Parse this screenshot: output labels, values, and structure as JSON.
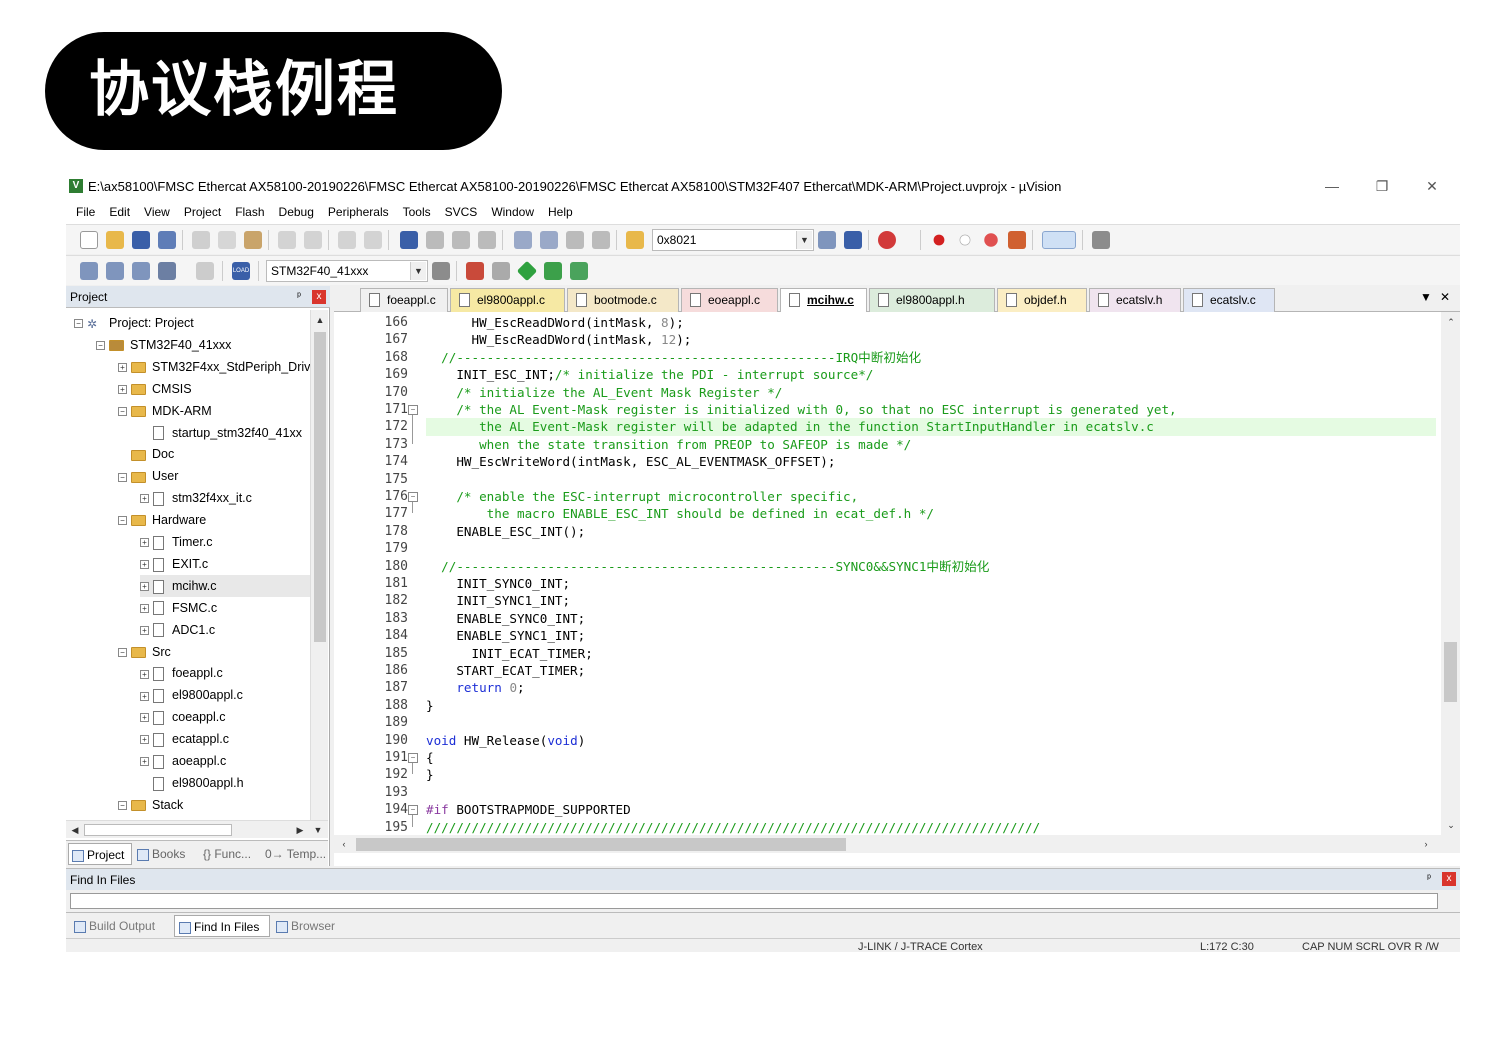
{
  "banner": {
    "title": "协议栈例程"
  },
  "window": {
    "title": "E:\\ax58100\\FMSC Ethercat AX58100-20190226\\FMSC Ethercat AX58100-20190226\\FMSC Ethercat AX58100\\STM32F407 Ethercat\\MDK-ARM\\Project.uvprojx - µVision",
    "controls": {
      "minimize": "—",
      "restore": "❐",
      "close": "✕"
    }
  },
  "menu": [
    "File",
    "Edit",
    "View",
    "Project",
    "Flash",
    "Debug",
    "Peripherals",
    "Tools",
    "SVCS",
    "Window",
    "Help"
  ],
  "toolbar": {
    "address_value": "0x8021",
    "target_value": "STM32F40_41xxx",
    "load_icon_label": "LOAD"
  },
  "project_panel": {
    "title": "Project",
    "pin": "ᵖ",
    "close": "x",
    "tree": [
      {
        "label": "Project: Project",
        "level": 0,
        "type": "project",
        "expander": "−"
      },
      {
        "label": "STM32F40_41xxx",
        "level": 1,
        "type": "target",
        "expander": "−"
      },
      {
        "label": "STM32F4xx_StdPeriph_Driv",
        "level": 2,
        "type": "folder",
        "expander": "+"
      },
      {
        "label": "CMSIS",
        "level": 2,
        "type": "folder",
        "expander": "+"
      },
      {
        "label": "MDK-ARM",
        "level": 2,
        "type": "folder",
        "expander": "−"
      },
      {
        "label": "startup_stm32f40_41xx",
        "level": 3,
        "type": "file",
        "expander": ""
      },
      {
        "label": "Doc",
        "level": 2,
        "type": "folder",
        "expander": ""
      },
      {
        "label": "User",
        "level": 2,
        "type": "folder",
        "expander": "−"
      },
      {
        "label": "stm32f4xx_it.c",
        "level": 3,
        "type": "file",
        "expander": "+"
      },
      {
        "label": "Hardware",
        "level": 2,
        "type": "folder",
        "expander": "−"
      },
      {
        "label": "Timer.c",
        "level": 3,
        "type": "file",
        "expander": "+"
      },
      {
        "label": "EXIT.c",
        "level": 3,
        "type": "file",
        "expander": "+"
      },
      {
        "label": "mcihw.c",
        "level": 3,
        "type": "file",
        "expander": "+",
        "selected": true
      },
      {
        "label": "FSMC.c",
        "level": 3,
        "type": "file",
        "expander": "+"
      },
      {
        "label": "ADC1.c",
        "level": 3,
        "type": "file",
        "expander": "+"
      },
      {
        "label": "Src",
        "level": 2,
        "type": "folder",
        "expander": "−"
      },
      {
        "label": "foeappl.c",
        "level": 3,
        "type": "file",
        "expander": "+"
      },
      {
        "label": "el9800appl.c",
        "level": 3,
        "type": "file",
        "expander": "+"
      },
      {
        "label": "coeappl.c",
        "level": 3,
        "type": "file",
        "expander": "+"
      },
      {
        "label": "ecatappl.c",
        "level": 3,
        "type": "file",
        "expander": "+"
      },
      {
        "label": "aoeappl.c",
        "level": 3,
        "type": "file",
        "expander": "+"
      },
      {
        "label": "el9800appl.h",
        "level": 3,
        "type": "file",
        "expander": ""
      },
      {
        "label": "Stack",
        "level": 2,
        "type": "folder",
        "expander": "−"
      }
    ],
    "bottom_tabs": [
      {
        "label": "Project",
        "active": true
      },
      {
        "label": "Books",
        "active": false
      },
      {
        "label": "{} Func...",
        "active": false
      },
      {
        "label": "0→ Temp...",
        "active": false
      }
    ]
  },
  "editor": {
    "tabs": [
      {
        "label": "foeappl.c",
        "color": "#f0f0f0",
        "active": false
      },
      {
        "label": "el9800appl.c",
        "color": "#f6e9a4",
        "active": false
      },
      {
        "label": "bootmode.c",
        "color": "#f4e8c8",
        "active": false
      },
      {
        "label": "eoeappl.c",
        "color": "#f6dcdc",
        "active": false
      },
      {
        "label": "mcihw.c",
        "color": "#ffffff",
        "active": true
      },
      {
        "label": "el9800appl.h",
        "color": "#dcecdc",
        "active": false
      },
      {
        "label": "objdef.h",
        "color": "#fbeec4",
        "active": false
      },
      {
        "label": "ecatslv.h",
        "color": "#f0e4ef",
        "active": false
      },
      {
        "label": "ecatslv.c",
        "color": "#dfe6f4",
        "active": false
      }
    ],
    "tabs_menu": "▼",
    "tabs_close": "✕",
    "lines": [
      {
        "n": "166",
        "html": "      HW_EscReadDWord(intMask, <span class='num'>8</span>);"
      },
      {
        "n": "167",
        "html": "      HW_EscReadDWord(intMask, <span class='num'>12</span>);"
      },
      {
        "n": "168",
        "html": "  <span class='cm'>//--------------------------------------------------IRQ中断初始化</span>"
      },
      {
        "n": "169",
        "html": "    INIT_ESC_INT;<span class='cm'>/* initialize the PDI - interrupt source*/</span>"
      },
      {
        "n": "170",
        "html": "    <span class='cm'>/* initialize the AL_Event Mask Register */</span>"
      },
      {
        "n": "171",
        "html": "    <span class='cm'>/* the AL Event-Mask register is initialized with 0, so that no ESC interrupt is generated yet,</span>",
        "fold": "−"
      },
      {
        "n": "172",
        "html": "       <span class='cm'>the AL Event-Mask register will be adapted in the function StartInputHandler in ecatslv.c</span>",
        "highlight": true
      },
      {
        "n": "173",
        "html": "       <span class='cm'>when the state transition from PREOP to SAFEOP is made */</span>"
      },
      {
        "n": "174",
        "html": "    HW_EscWriteWord(intMask, ESC_AL_EVENTMASK_OFFSET);"
      },
      {
        "n": "175",
        "html": ""
      },
      {
        "n": "176",
        "html": "    <span class='cm'>/* enable the ESC-interrupt microcontroller specific,</span>",
        "fold": "−"
      },
      {
        "n": "177",
        "html": "        <span class='cm'>the macro ENABLE_ESC_INT should be defined in ecat_def.h */</span>"
      },
      {
        "n": "178",
        "html": "    ENABLE_ESC_INT();"
      },
      {
        "n": "179",
        "html": ""
      },
      {
        "n": "180",
        "html": "  <span class='cm'>//--------------------------------------------------SYNC0&amp;&amp;SYNC1中断初始化</span>"
      },
      {
        "n": "181",
        "html": "    INIT_SYNC0_INT;"
      },
      {
        "n": "182",
        "html": "    INIT_SYNC1_INT;"
      },
      {
        "n": "183",
        "html": "    ENABLE_SYNC0_INT;"
      },
      {
        "n": "184",
        "html": "    ENABLE_SYNC1_INT;"
      },
      {
        "n": "185",
        "html": "      INIT_ECAT_TIMER;"
      },
      {
        "n": "186",
        "html": "    START_ECAT_TIMER;"
      },
      {
        "n": "187",
        "html": "    <span class='kw'>return</span> <span class='num'>0</span>;"
      },
      {
        "n": "188",
        "html": "}"
      },
      {
        "n": "189",
        "html": ""
      },
      {
        "n": "190",
        "html": "<span class='kw'>void</span> HW_Release(<span class='kw'>void</span>)"
      },
      {
        "n": "191",
        "html": "{",
        "fold": "−"
      },
      {
        "n": "192",
        "html": "}"
      },
      {
        "n": "193",
        "html": ""
      },
      {
        "n": "194",
        "html": "<span class='pp'>#if</span> BOOTSTRAPMODE_SUPPORTED",
        "fold": "−"
      },
      {
        "n": "195",
        "html": "<span class='cm'>/////////////////////////////////////////////////////////////////////////////////</span>"
      }
    ]
  },
  "find_in_files": {
    "title": "Find In Files",
    "pin": "ᵖ",
    "close": "x"
  },
  "output_tabs": [
    {
      "label": "Build Output",
      "active": false
    },
    {
      "label": "Find In Files",
      "active": true
    },
    {
      "label": "Browser",
      "active": false
    }
  ],
  "status": {
    "debugger": "J-LINK / J-TRACE Cortex",
    "position": "L:172 C:30",
    "flags": "CAP  NUM  SCRL  OVR  R /W"
  },
  "colors": {
    "banner_bg": "#000000",
    "comment": "#1a9b1a",
    "keyword": "#1d2fd6",
    "highlight_line": "#e5fbe2"
  }
}
